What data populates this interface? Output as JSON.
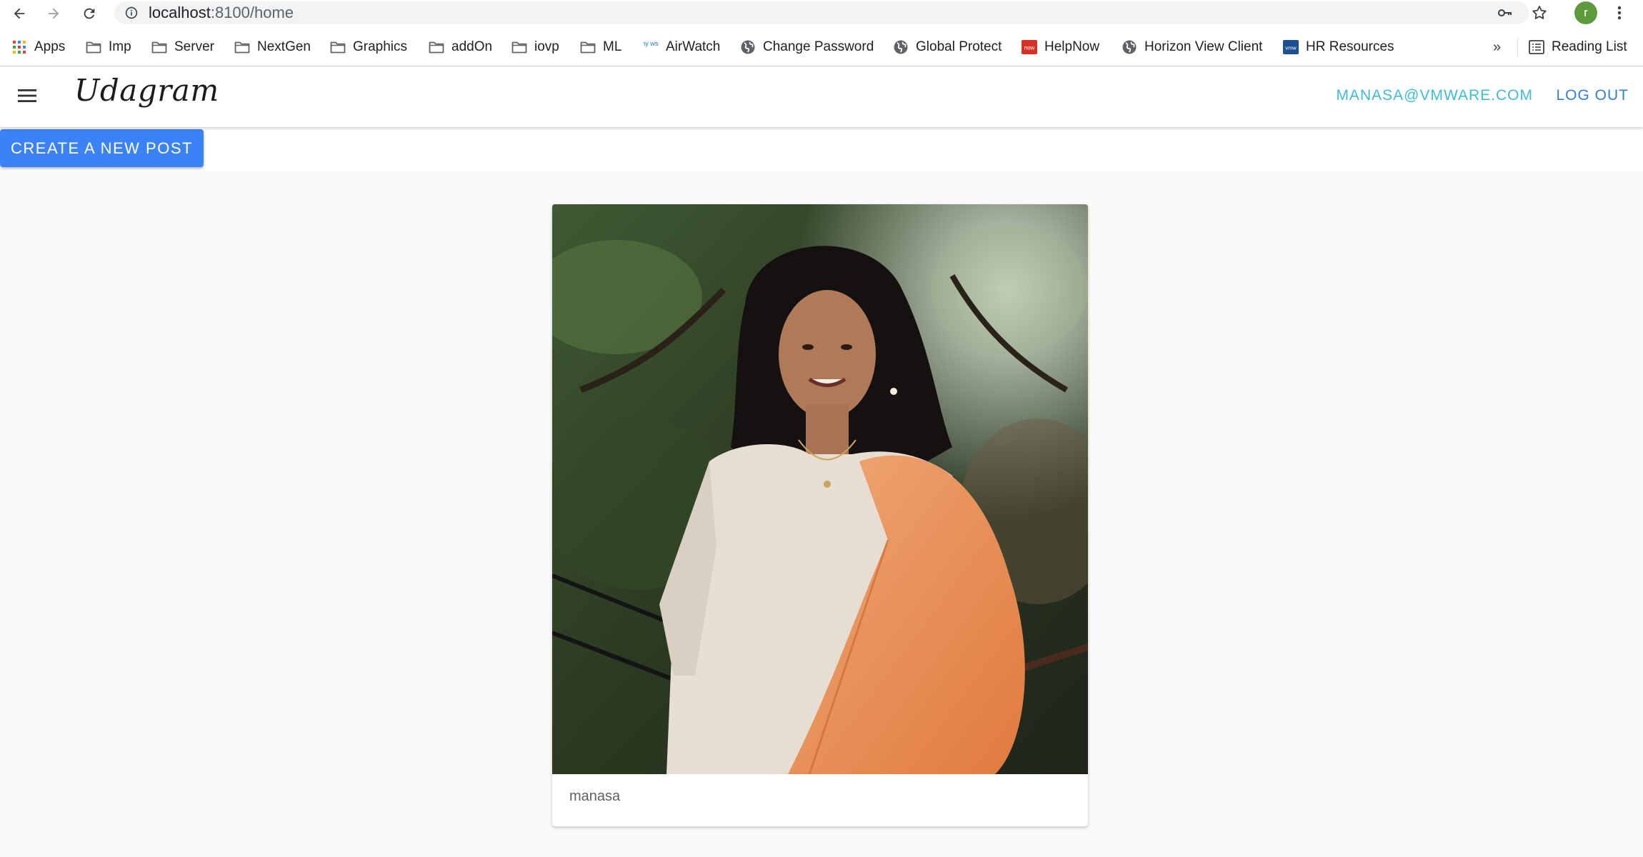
{
  "browser": {
    "url_host": "localhost",
    "url_path": ":8100/home",
    "profile_initial": "r",
    "nav_icons": [
      "back-arrow-icon",
      "forward-arrow-icon",
      "reload-icon"
    ],
    "omnibox_icons": [
      "info-icon",
      "key-icon",
      "star-icon"
    ],
    "bookmarks": [
      {
        "label": "Apps",
        "icon": "apps-grid-icon"
      },
      {
        "label": "Imp",
        "icon": "folder-icon"
      },
      {
        "label": "Server",
        "icon": "folder-icon"
      },
      {
        "label": "NextGen",
        "icon": "folder-icon"
      },
      {
        "label": "Graphics",
        "icon": "folder-icon"
      },
      {
        "label": "addOn",
        "icon": "folder-icon"
      },
      {
        "label": "iovp",
        "icon": "folder-icon"
      },
      {
        "label": "ML",
        "icon": "folder-icon"
      },
      {
        "label": "AirWatch",
        "icon": "mywso-icon"
      },
      {
        "label": "Change Password",
        "icon": "globe-icon"
      },
      {
        "label": "Global Protect",
        "icon": "globe-icon"
      },
      {
        "label": "HelpNow",
        "icon": "now-icon"
      },
      {
        "label": "Horizon View Client",
        "icon": "globe-icon"
      },
      {
        "label": "HR Resources",
        "icon": "vmw-icon"
      }
    ],
    "more_bookmarks": "»",
    "reading_list": "Reading List",
    "icon_labels": {
      "mywso": "my wso",
      "now": "now",
      "vmw": "vmw"
    }
  },
  "app": {
    "brand": "Udagram",
    "user_email": "MANASA@VMWARE.COM",
    "logout_label": "LOG OUT",
    "create_post_label": "CREATE A NEW POST"
  },
  "feed": {
    "posts": [
      {
        "caption": "manasa",
        "image": "portrait photo"
      }
    ]
  },
  "colors": {
    "primary": "#3b82f6",
    "user_link": "#3dbbd8",
    "logout": "#2f7ed8",
    "background": "#fafafa"
  }
}
